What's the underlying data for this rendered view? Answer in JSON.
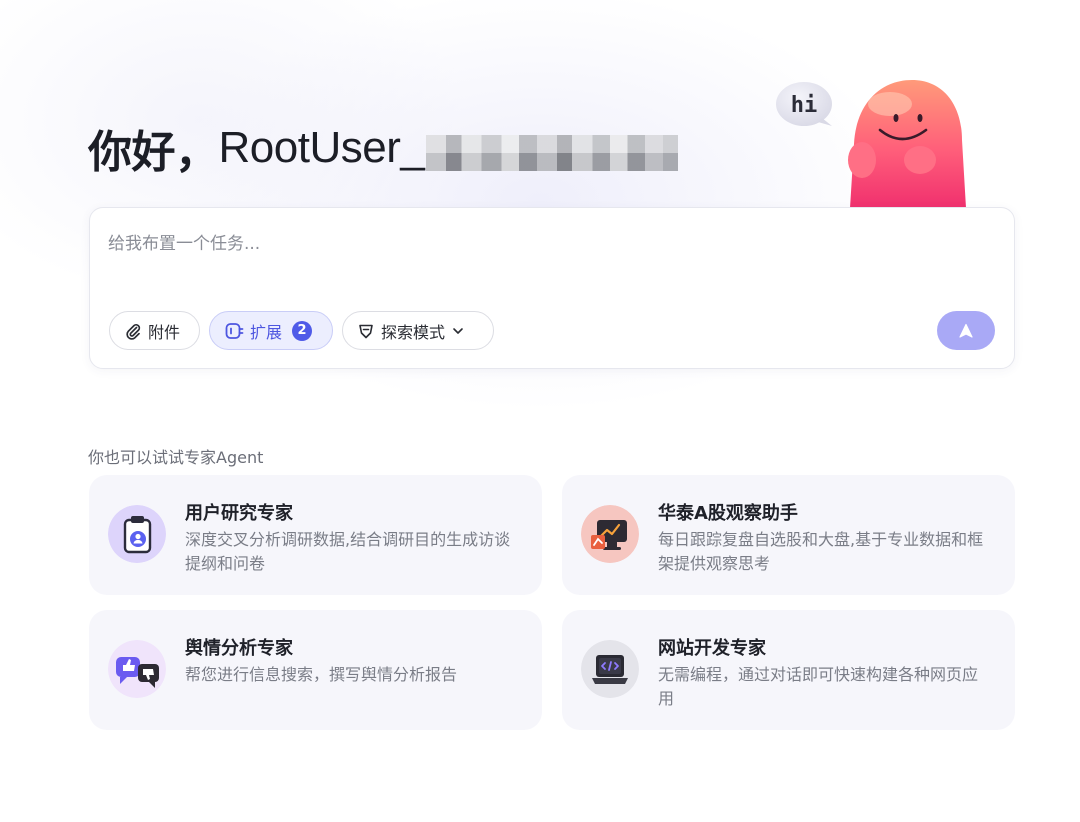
{
  "greeting": {
    "hello": "你好，",
    "username": "RootUser_"
  },
  "mascot": {
    "bubble_text": "hi"
  },
  "composer": {
    "placeholder": "给我布置一个任务...",
    "attach_label": "附件",
    "extend_label": "扩展",
    "extend_count": "2",
    "explore_label": "探索模式"
  },
  "experts": {
    "section_title": "你也可以试试专家Agent",
    "items": [
      {
        "name": "用户研究专家",
        "desc": "深度交叉分析调研数据,结合调研目的生成访谈提纲和问卷",
        "icon": "clipboard-user-icon"
      },
      {
        "name": "华泰A股观察助手",
        "desc": "每日跟踪复盘自选股和大盘,基于专业数据和框架提供观察思考",
        "icon": "stock-monitor-icon"
      },
      {
        "name": "舆情分析专家",
        "desc": "帮您进行信息搜索，撰写舆情分析报告",
        "icon": "thumbs-chat-icon"
      },
      {
        "name": "网站开发专家",
        "desc": "无需编程，通过对话即可快速构建各种网页应用",
        "icon": "code-laptop-icon"
      }
    ]
  },
  "colors": {
    "accent": "#4f5be8",
    "send_button": "#a9a9f6",
    "card_bg": "#f6f6fb"
  }
}
